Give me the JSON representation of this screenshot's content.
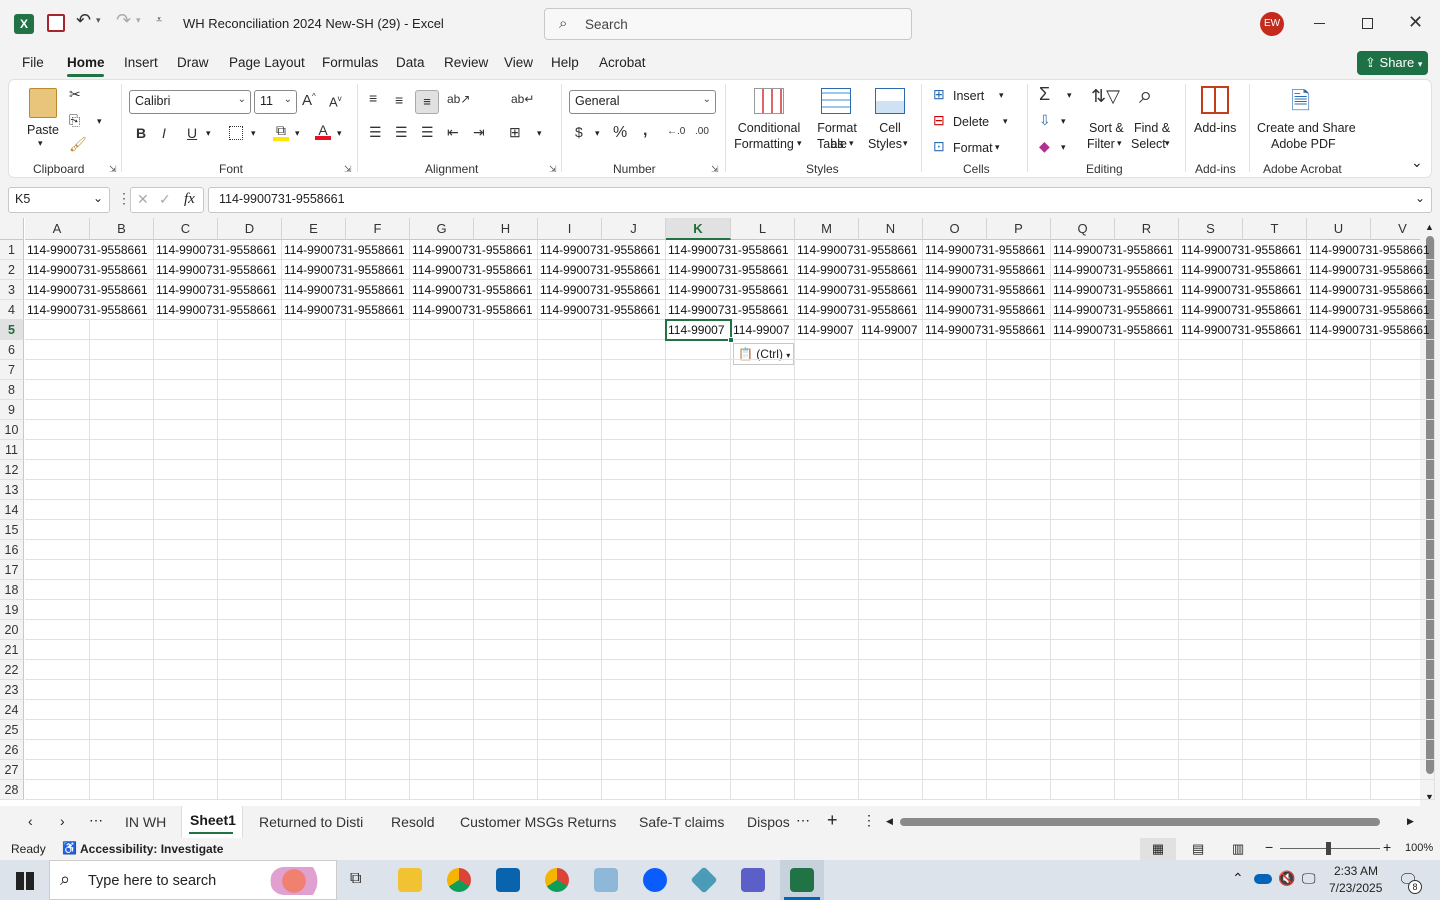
{
  "titlebar": {
    "doc_title": "WH Reconciliation 2024 New-SH (29)  -  Excel",
    "search_placeholder": "Search",
    "user_initials": "EW"
  },
  "menu": [
    "File",
    "Home",
    "Insert",
    "Draw",
    "Page Layout",
    "Formulas",
    "Data",
    "Review",
    "View",
    "Help",
    "Acrobat"
  ],
  "share_label": "Share",
  "ribbon": {
    "clipboard": {
      "label": "Clipboard",
      "paste": "Paste"
    },
    "font": {
      "label": "Font",
      "name": "Calibri",
      "size": "11"
    },
    "alignment": {
      "label": "Alignment"
    },
    "number": {
      "label": "Number",
      "format": "General"
    },
    "styles": {
      "label": "Styles",
      "conditional": "Conditional",
      "formatting": "Formatting",
      "format_as": "Format as",
      "table": "Table",
      "cell": "Cell",
      "cell_styles": "Styles"
    },
    "cells": {
      "label": "Cells",
      "insert": "Insert",
      "delete": "Delete",
      "format": "Format"
    },
    "editing": {
      "label": "Editing",
      "sort": "Sort &",
      "filter": "Filter",
      "find": "Find &",
      "select": "Select"
    },
    "addins": {
      "label": "Add-ins",
      "btn": "Add-ins"
    },
    "acrobat": {
      "label": "Adobe Acrobat",
      "line1": "Create and Share",
      "line2": "Adobe PDF"
    }
  },
  "formula_bar": {
    "name_box": "K5",
    "fx": "fx",
    "value": "114-9900731-9558661"
  },
  "columns": [
    "A",
    "B",
    "C",
    "D",
    "E",
    "F",
    "G",
    "H",
    "I",
    "J",
    "K",
    "L",
    "M",
    "N",
    "O",
    "P",
    "Q",
    "R",
    "S",
    "T",
    "U",
    "V"
  ],
  "rows": [
    "1",
    "2",
    "3",
    "4",
    "5",
    "6",
    "7",
    "8",
    "9",
    "10",
    "11",
    "12",
    "13",
    "14",
    "15",
    "16",
    "17",
    "18",
    "19",
    "20",
    "21",
    "22",
    "23",
    "24",
    "25",
    "26",
    "27",
    "28"
  ],
  "cell_value": "114-9900731-9558661",
  "row5_truncated": "114-99007",
  "paste_options": "(Ctrl)",
  "sheet_tabs": [
    "IN WH",
    "Sheet1",
    "Returned to Disti",
    "Resold",
    "Customer MSGs Returns",
    "Safe-T claims",
    "Dispos"
  ],
  "active_sheet": "Sheet1",
  "status": {
    "ready": "Ready",
    "accessibility": "Accessibility: Investigate",
    "zoom": "100%"
  },
  "taskbar": {
    "search_placeholder": "Type here to search",
    "time": "2:33 AM",
    "date": "7/23/2025",
    "notif_count": "8"
  },
  "colors": {
    "excel_green": "#217346",
    "share_green": "#1e7145",
    "avatar": "#c42b1c"
  }
}
